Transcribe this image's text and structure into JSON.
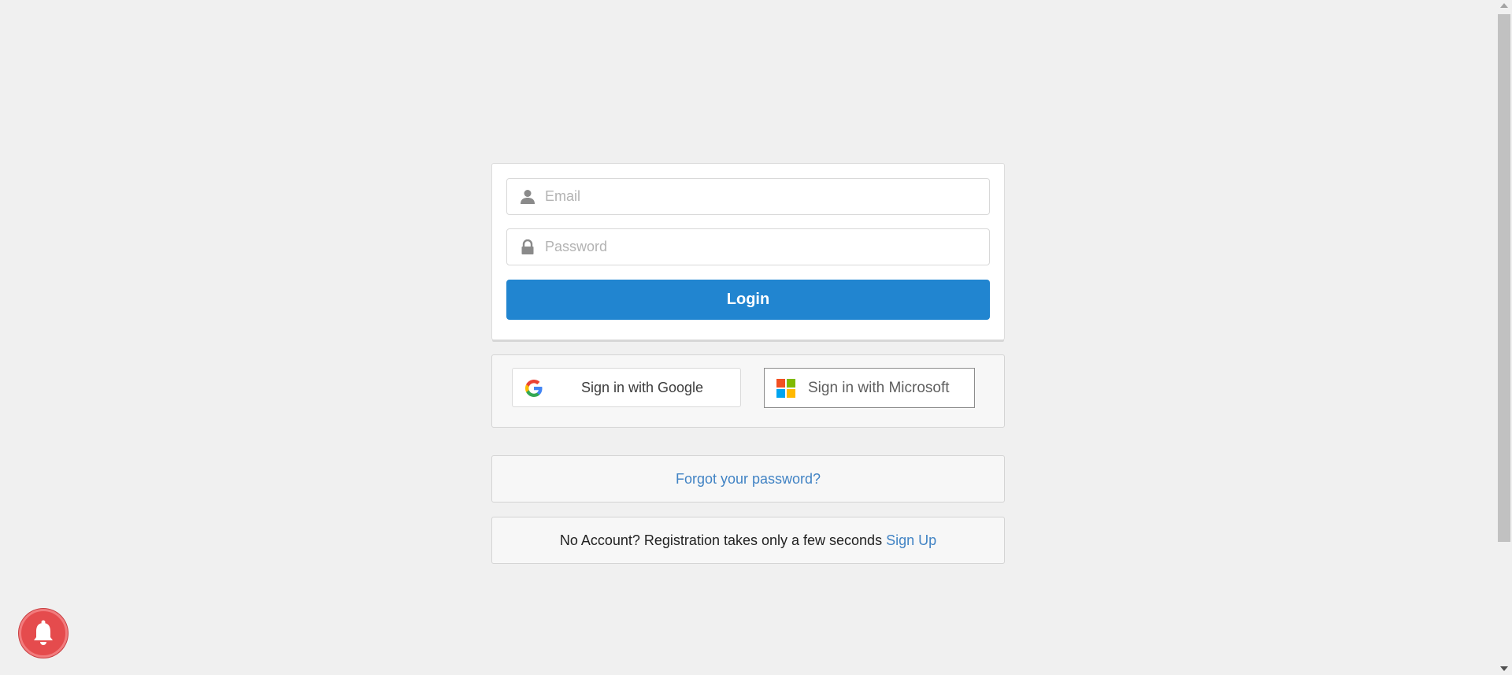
{
  "login_form": {
    "email_placeholder": "Email",
    "password_placeholder": "Password",
    "login_label": "Login"
  },
  "social": {
    "google_label": "Sign in with Google",
    "microsoft_label": "Sign in with Microsoft"
  },
  "forgot": {
    "link_text": "Forgot your password?"
  },
  "signup": {
    "prompt_text": "No Account? Registration takes only a few seconds",
    "link_text": "Sign Up"
  },
  "icons": {
    "email": "user-icon",
    "password": "lock-icon",
    "google": "google-logo-icon",
    "microsoft": "microsoft-logo-icon",
    "notification": "bell-icon"
  },
  "colors": {
    "primary": "#2185d0",
    "link": "#4183c4",
    "notification": "#e54b4d",
    "background": "#f0f0f0"
  }
}
